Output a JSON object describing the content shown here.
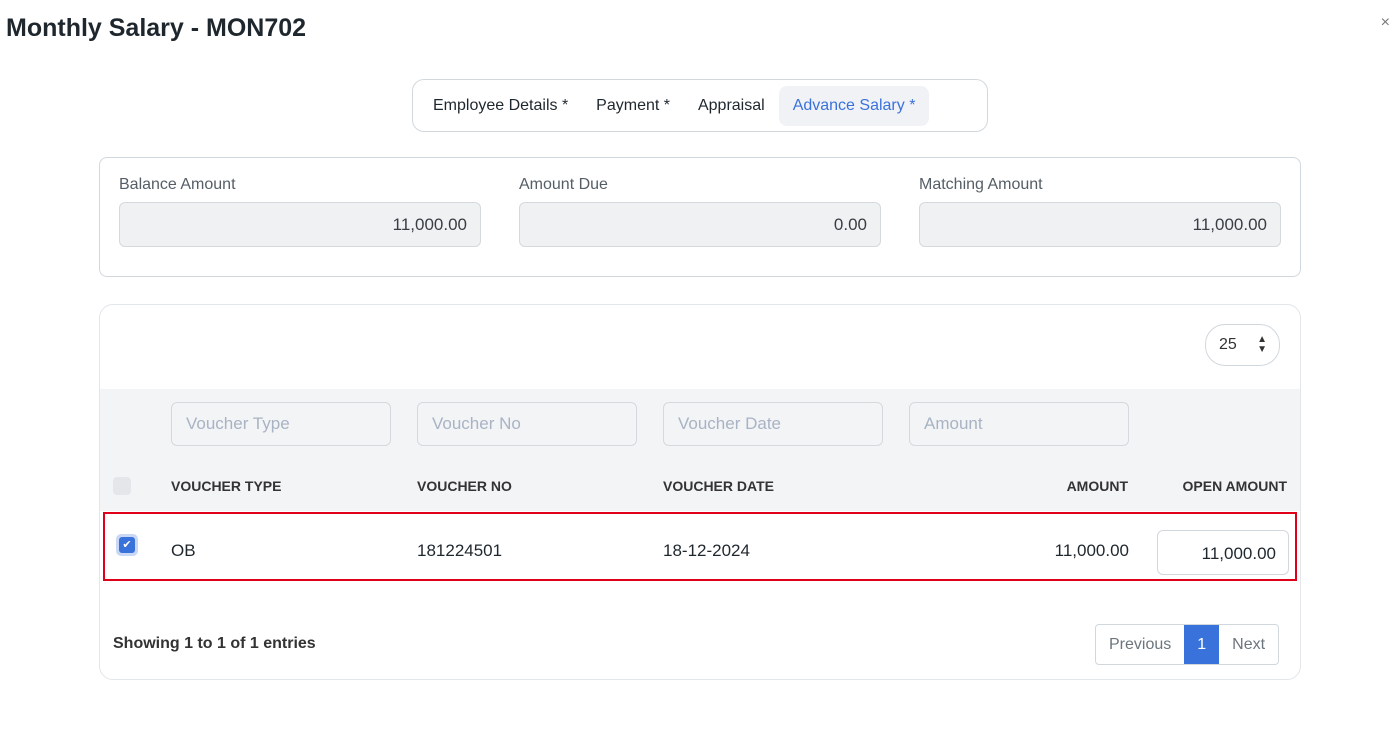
{
  "dialog": {
    "title": "Monthly Salary - MON702",
    "close_icon": "×"
  },
  "tabs": [
    {
      "label": "Employee Details *"
    },
    {
      "label": "Payment *"
    },
    {
      "label": "Appraisal"
    },
    {
      "label": "Advance Salary *",
      "active": true
    }
  ],
  "summary": {
    "balance": {
      "label": "Balance Amount",
      "value": "11,000.00"
    },
    "due": {
      "label": "Amount Due",
      "value": "0.00"
    },
    "matching": {
      "label": "Matching Amount",
      "value": "11,000.00"
    }
  },
  "table": {
    "page_size": "25",
    "filters": {
      "voucher_type": "Voucher Type",
      "voucher_no": "Voucher No",
      "voucher_date": "Voucher Date",
      "amount": "Amount"
    },
    "columns": [
      "VOUCHER TYPE",
      "VOUCHER NO",
      "VOUCHER DATE",
      "AMOUNT",
      "OPEN AMOUNT"
    ],
    "rows": [
      {
        "checked": true,
        "voucher_type": "OB",
        "voucher_no": "181224501",
        "voucher_date": "18-12-2024",
        "amount": "11,000.00",
        "open_amount": "11,000.00"
      }
    ],
    "info": "Showing 1 to 1 of 1 entries",
    "pagination": {
      "previous": "Previous",
      "current": "1",
      "next": "Next"
    }
  },
  "colors": {
    "accent": "#3a72dc",
    "highlight": "#e0001a"
  }
}
